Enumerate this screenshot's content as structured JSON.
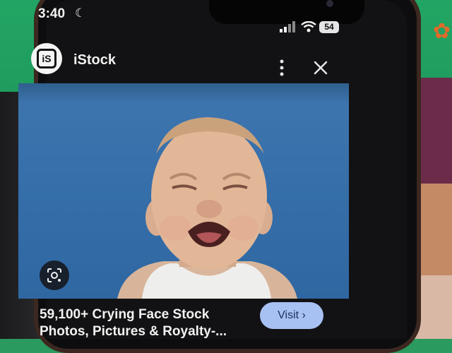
{
  "status_bar": {
    "time": "3:40",
    "battery": "54",
    "icons": [
      "moon-icon",
      "signal-icon",
      "wifi-icon",
      "battery-icon"
    ]
  },
  "header": {
    "site_name": "iStock",
    "logo_text": "iS",
    "icons": [
      "kebab-menu-icon",
      "close-icon"
    ]
  },
  "result": {
    "title": "59,100+ Crying Face Stock Photos, Pictures & Royalty-...",
    "visit_label": "Visit ›",
    "lens_icon": "google-lens-icon"
  },
  "colors": {
    "photo_background": "#3f76b0",
    "visit_button": "#a8c1f3",
    "screen_background": "#121214"
  }
}
